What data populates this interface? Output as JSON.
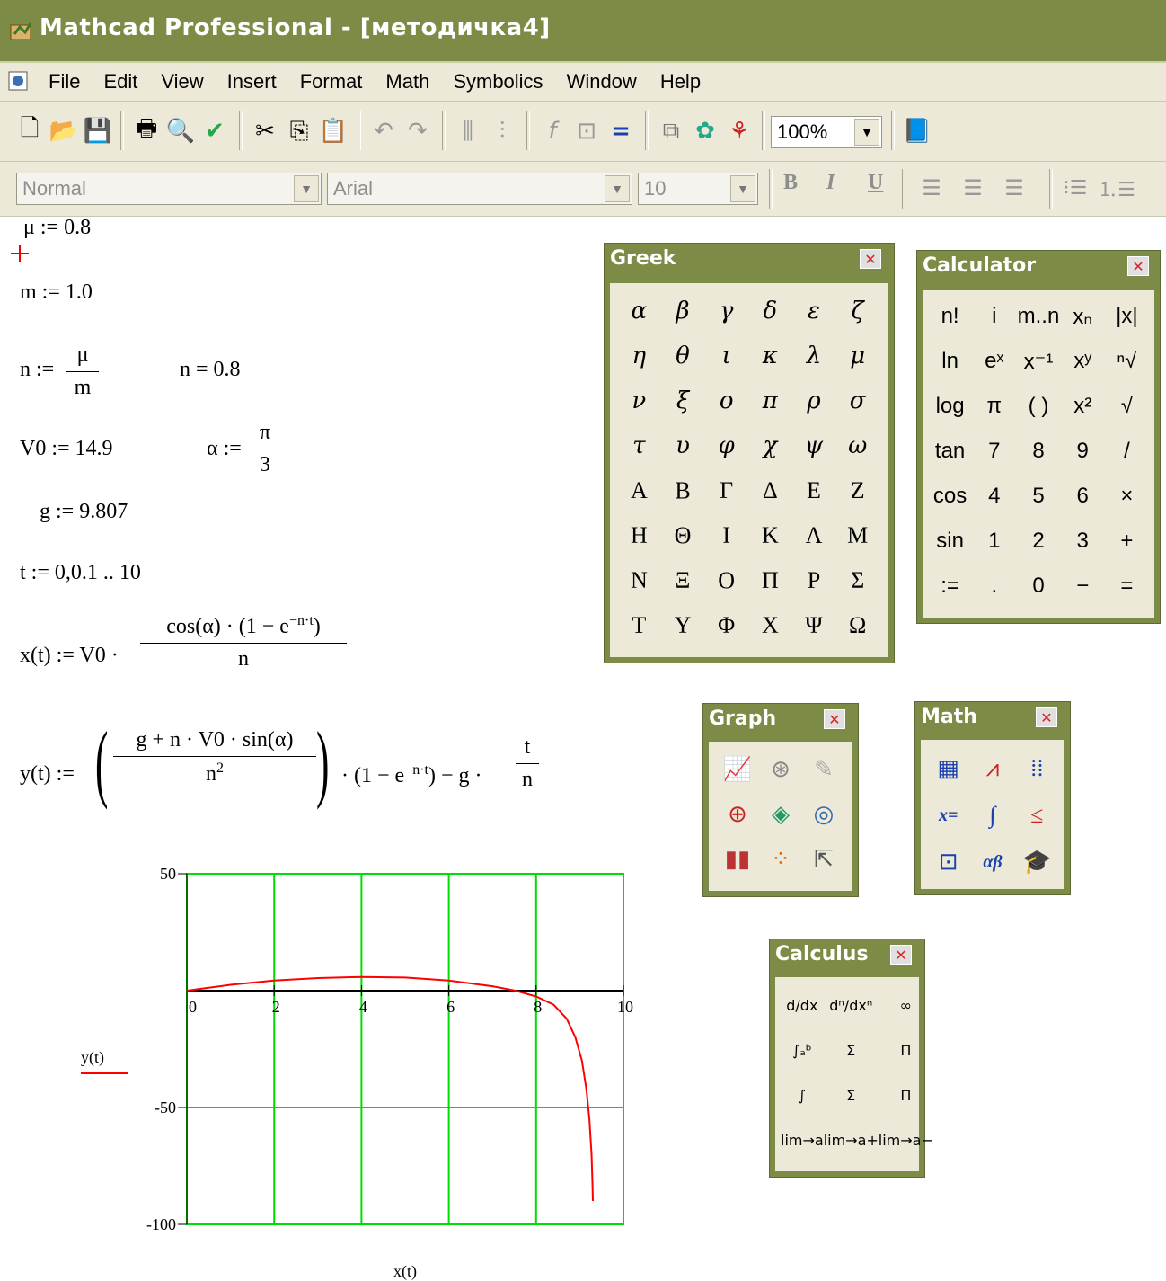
{
  "window": {
    "title": "Mathcad Professional - [методичка4]"
  },
  "menu": [
    "File",
    "Edit",
    "View",
    "Insert",
    "Format",
    "Math",
    "Symbolics",
    "Window",
    "Help"
  ],
  "toolbar": {
    "zoom": "100%"
  },
  "format_bar": {
    "style": "Normal",
    "font": "Arial",
    "size": "10",
    "bold": "B",
    "italic": "I",
    "underline": "U"
  },
  "worksheet": {
    "mu": "μ := 0.8",
    "m": "m := 1.0",
    "n_lhs": "n :=",
    "n_num": "μ",
    "n_den": "m",
    "n_result": "n = 0.8",
    "v0": "V0 := 14.9",
    "alpha_lhs": "α :=",
    "alpha_num": "π",
    "alpha_den": "3",
    "g": "g := 9.807",
    "t": "t := 0,0.1 .. 10",
    "x_lhs": "x(t) := V0 ·",
    "x_num": "cos(α) · (1 − e",
    "x_exp": "−n·t",
    "x_num_end": ")",
    "x_den": "n",
    "y_lhs": "y(t) :=",
    "y_num": "g + n · V0 · sin(α)",
    "y_den": "n",
    "y_den_exp": "2",
    "y_mid": "· (1 − e",
    "y_exp": "−n·t",
    "y_mid_end": ") − g ·",
    "y_t_num": "t",
    "y_t_den": "n"
  },
  "palettes": {
    "greek": {
      "title": "Greek",
      "letters": [
        "α",
        "β",
        "γ",
        "δ",
        "ε",
        "ζ",
        "η",
        "θ",
        "ι",
        "κ",
        "λ",
        "μ",
        "ν",
        "ξ",
        "ο",
        "π",
        "ρ",
        "σ",
        "τ",
        "υ",
        "φ",
        "χ",
        "ψ",
        "ω",
        "Α",
        "Β",
        "Γ",
        "Δ",
        "Ε",
        "Ζ",
        "Η",
        "Θ",
        "Ι",
        "Κ",
        "Λ",
        "Μ",
        "Ν",
        "Ξ",
        "Ο",
        "Π",
        "Ρ",
        "Σ",
        "Τ",
        "Υ",
        "Φ",
        "Χ",
        "Ψ",
        "Ω"
      ]
    },
    "calculator": {
      "title": "Calculator",
      "keys": [
        "n!",
        "i",
        "m..n",
        "xₙ",
        "|x|",
        "ln",
        "eˣ",
        "x⁻¹",
        "xʸ",
        "ⁿ√",
        "log",
        "π",
        "( )",
        "x²",
        "√",
        "tan",
        "7",
        "8",
        "9",
        "/",
        "cos",
        "4",
        "5",
        "6",
        "×",
        "sin",
        "1",
        "2",
        "3",
        "+",
        ":=",
        ".",
        "0",
        "−",
        "="
      ]
    },
    "graph": {
      "title": "Graph",
      "icons": [
        "xy-plot-icon",
        "polar-plot-icon",
        "trace-icon",
        "surface-plot-icon",
        "3d-plot-icon",
        "contour-plot-icon",
        "bar-plot-icon",
        "scatter-plot-icon",
        "vector-field-icon"
      ]
    },
    "math": {
      "title": "Math",
      "icons": [
        "calculator-toolbar-icon",
        "graph-toolbar-icon",
        "matrix-toolbar-icon",
        "evaluation-toolbar-icon",
        "calculus-toolbar-icon",
        "boolean-toolbar-icon",
        "programming-toolbar-icon",
        "greek-toolbar-icon",
        "symbolic-toolbar-icon"
      ]
    },
    "calculus": {
      "title": "Calculus",
      "keys": [
        "d/dx",
        "dⁿ/dxⁿ",
        "∞",
        "∫ₐᵇ",
        "Σ",
        "Π",
        "∫",
        "Σ",
        "Π",
        "lim→a",
        "lim→a+",
        "lim→a−"
      ]
    }
  },
  "chart_data": {
    "type": "line",
    "xlabel": "x(t)",
    "ylabel": "y(t)",
    "xlim": [
      0,
      10
    ],
    "ylim": [
      -100,
      50
    ],
    "x_ticks": [
      "0",
      "2",
      "4",
      "6",
      "8",
      "10"
    ],
    "y_ticks": [
      "50",
      "-50",
      "-100"
    ],
    "grid": true,
    "series": [
      {
        "name": "y(t)",
        "color": "#ff0000",
        "x": [
          0,
          1,
          2,
          3,
          4,
          5,
          6,
          7,
          7.5,
          8,
          8.4,
          8.7,
          8.9,
          9.05,
          9.15,
          9.22,
          9.27,
          9.29,
          9.3
        ],
        "y": [
          0,
          2.5,
          4.3,
          5.4,
          5.9,
          5.6,
          4.3,
          1.9,
          0.1,
          -2.5,
          -6,
          -12,
          -20,
          -30,
          -42,
          -55,
          -70,
          -82,
          -90
        ]
      }
    ]
  }
}
